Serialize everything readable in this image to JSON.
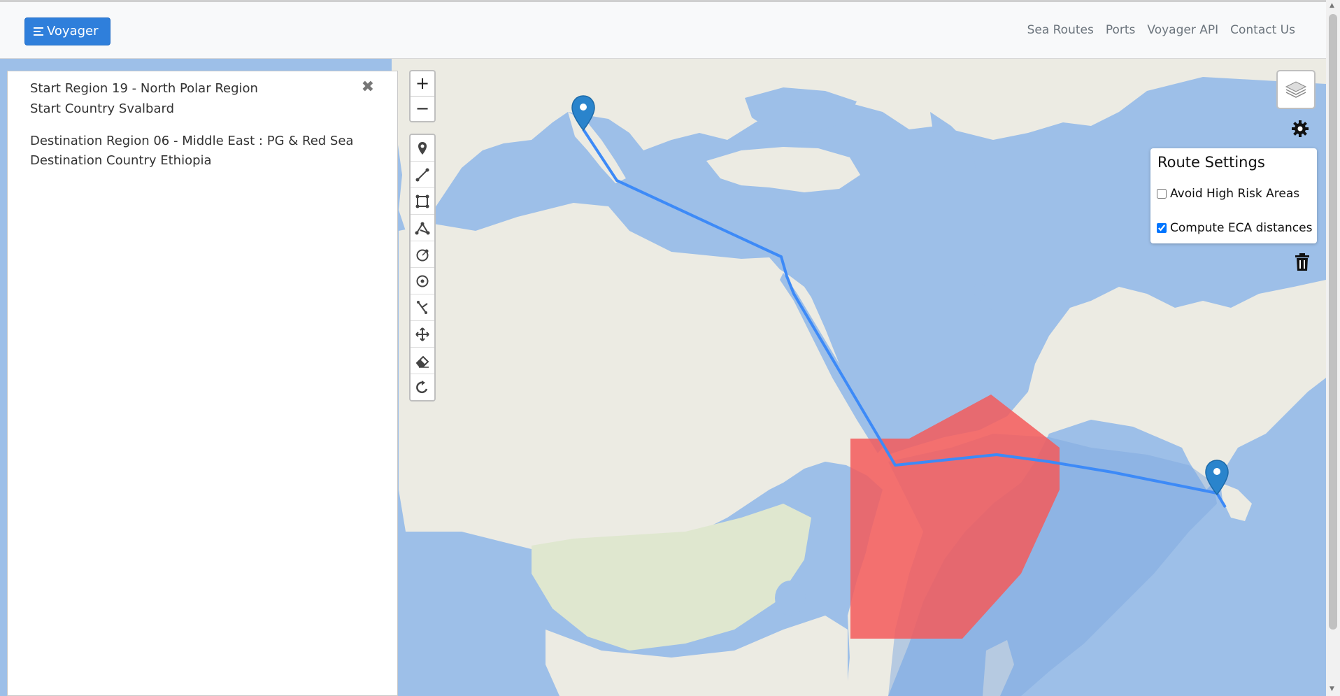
{
  "navbar": {
    "brand_label": "Voyager",
    "links": [
      "Sea Routes",
      "Ports",
      "Voyager API",
      "Contact Us"
    ]
  },
  "side_panel": {
    "start_region": "Start Region 19 - North Polar Region",
    "start_country": "Start Country Svalbard",
    "destination_region": "Destination Region 06 - Middle East : PG & Red Sea",
    "destination_country": "Destination Country Ethiopia"
  },
  "map": {
    "zoom_in_label": "+",
    "zoom_out_label": "−",
    "draw_tools": [
      "marker-icon",
      "polyline-icon",
      "rectangle-icon",
      "polygon-icon",
      "circle-icon",
      "circle-marker-icon",
      "cut-icon",
      "move-icon",
      "eraser-icon",
      "rotate-icon"
    ],
    "route_color": "#3d8af7",
    "high_risk_area_color": "#f45b5b",
    "pin_color": "#2a84cc"
  },
  "route_settings": {
    "title": "Route Settings",
    "options": [
      {
        "label": "Avoid High Risk Areas",
        "checked": false
      },
      {
        "label": "Compute ECA distances",
        "checked": true
      }
    ]
  }
}
